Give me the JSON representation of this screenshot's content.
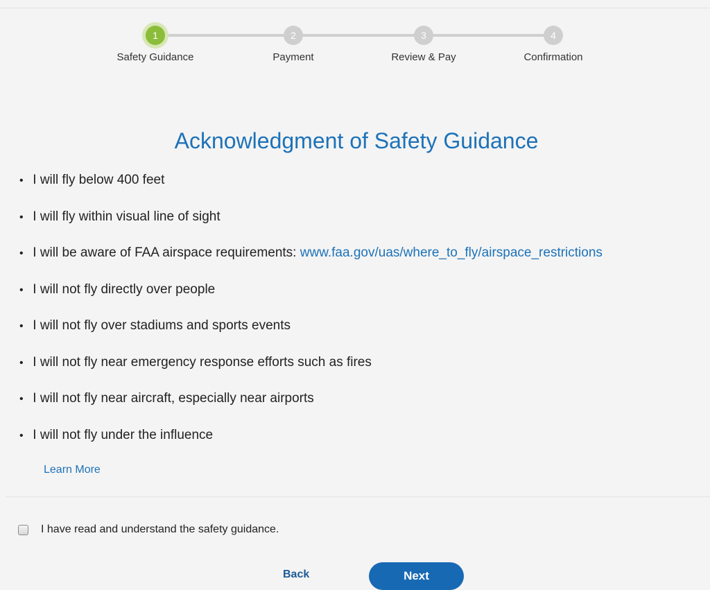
{
  "stepper": {
    "steps": [
      {
        "number": "1",
        "label": "Safety Guidance",
        "state": "active"
      },
      {
        "number": "2",
        "label": "Payment",
        "state": "pending"
      },
      {
        "number": "3",
        "label": "Review & Pay",
        "state": "pending"
      },
      {
        "number": "4",
        "label": "Confirmation",
        "state": "pending"
      }
    ]
  },
  "main": {
    "title": "Acknowledgment of Safety Guidance",
    "bullet": "•",
    "items": [
      {
        "text": "I will fly below 400 feet"
      },
      {
        "text": "I will fly within visual line of sight"
      },
      {
        "text": "I will be aware of FAA airspace requirements: ",
        "link": "www.faa.gov/uas/where_to_fly/airspace_restrictions"
      },
      {
        "text": "I will not fly directly over people"
      },
      {
        "text": "I will not fly over stadiums and sports events"
      },
      {
        "text": "I will not fly near emergency response efforts such as fires"
      },
      {
        "text": "I will not fly near aircraft, especially near airports"
      },
      {
        "text": "I will not fly under the influence"
      }
    ],
    "learn_more": "Learn More"
  },
  "acknowledgment": {
    "label": "I have read and understand the safety guidance.",
    "checked": false
  },
  "footer": {
    "back_label": "Back",
    "next_label": "Next"
  },
  "colors": {
    "accent": "#1d72b8",
    "active_step": "#8bbd3a",
    "pending_step": "#cfcfcf",
    "button": "#1869b3"
  }
}
